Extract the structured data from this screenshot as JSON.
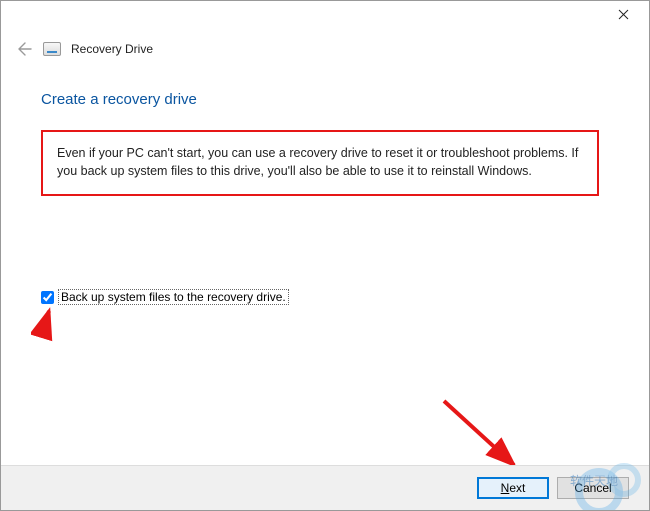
{
  "titlebar": {
    "close_aria": "Close"
  },
  "header": {
    "window_title": "Recovery Drive"
  },
  "content": {
    "heading": "Create a recovery drive",
    "description": "Even if your PC can't start, you can use a recovery drive to reset it or troubleshoot problems. If you back up system files to this drive, you'll also be able to use it to reinstall Windows."
  },
  "checkbox": {
    "checked": true,
    "label": "Back up system files to the recovery drive."
  },
  "footer": {
    "next_prefix": "N",
    "next_rest": "ext",
    "cancel_label": "Cancel"
  },
  "watermark": {
    "text": "软件天地"
  }
}
